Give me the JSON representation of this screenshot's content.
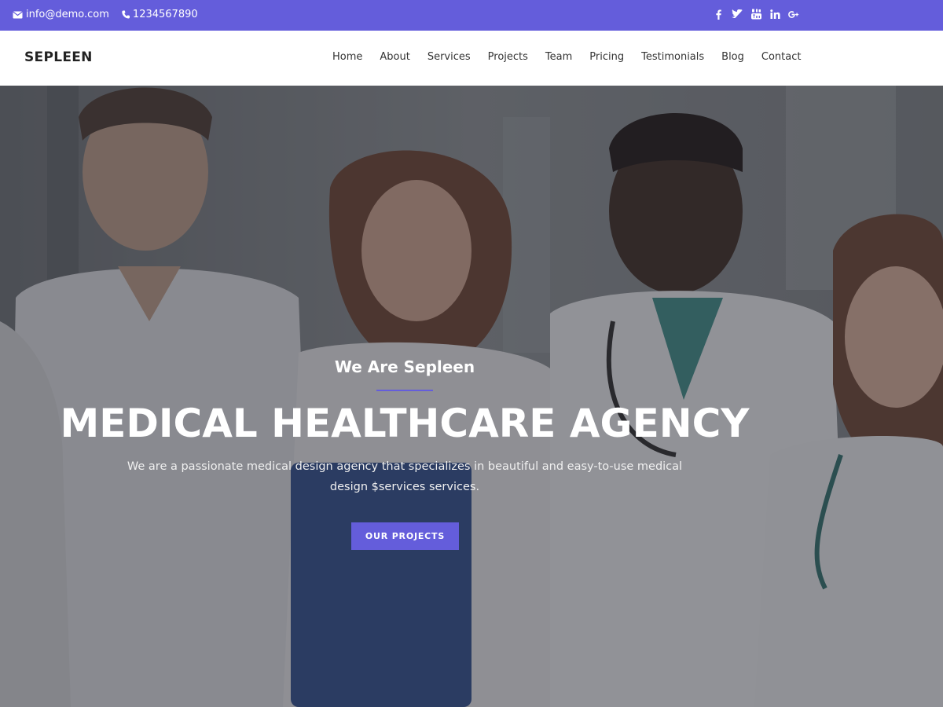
{
  "topbar": {
    "email": "info@demo.com",
    "phone": "1234567890",
    "social": [
      {
        "icon": "facebook-icon",
        "glyph": "f"
      },
      {
        "icon": "twitter-icon",
        "glyph": "t"
      },
      {
        "icon": "youtube-icon",
        "glyph": "y"
      },
      {
        "icon": "linkedin-icon",
        "glyph": "in"
      },
      {
        "icon": "google-plus-icon",
        "glyph": "G+"
      }
    ],
    "background_color": "#645ddb"
  },
  "navbar": {
    "brand": "SEPLEEN",
    "items": [
      {
        "label": "Home"
      },
      {
        "label": "About"
      },
      {
        "label": "Services"
      },
      {
        "label": "Projects"
      },
      {
        "label": "Team"
      },
      {
        "label": "Pricing"
      },
      {
        "label": "Testimonials"
      },
      {
        "label": "Blog"
      },
      {
        "label": "Contact"
      }
    ]
  },
  "hero": {
    "subtitle": "We Are Sepleen",
    "title": "MEDICAL HEALTHCARE AGENCY",
    "description": "We are a passionate medical design agency that specializes in beautiful and easy-to-use medical design $services services.",
    "button_label": "OUR PROJECTS",
    "accent_color": "#645ddb"
  }
}
